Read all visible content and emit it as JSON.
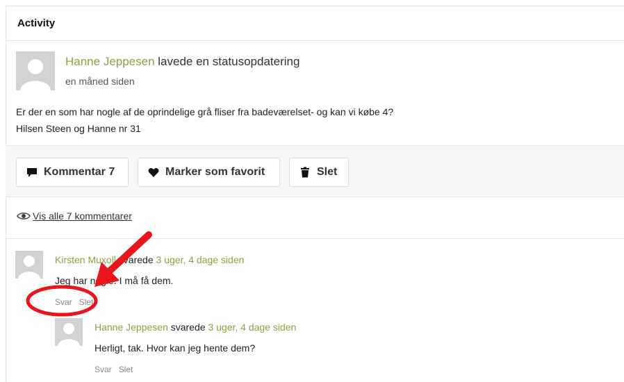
{
  "panel": {
    "title": "Activity"
  },
  "post": {
    "author": "Hanne Jeppesen",
    "action": "lavede en statusopdatering",
    "time": "en måned siden",
    "body_line1": "Er der en som har nogle af de oprindelige grå fliser fra badeværelset- og kan vi købe 4?",
    "body_line2": "Hilsen Steen og Hanne nr 31"
  },
  "actions": {
    "comment_label": "Kommentar 7",
    "favorite_label": "Marker som favorit",
    "delete_label": "Slet"
  },
  "view_all": {
    "label": "Vis alle 7 kommentarer"
  },
  "comments": [
    {
      "author": "Kirsten Muxoll",
      "verb": " svarede ",
      "time": "3 uger, 4 dage siden",
      "text": "Jeg har nogle. I må få dem.",
      "reply_label": "Svar",
      "delete_label": "Slet"
    },
    {
      "author": "Hanne Jeppesen",
      "verb": " svarede ",
      "time": "3 uger, 4 dage siden",
      "text": "Herligt, tak. Hvor kan jeg hente dem?",
      "reply_label": "Svar",
      "delete_label": "Slet"
    }
  ],
  "colors": {
    "accent": "#8ba446",
    "annotation": "#e8151b"
  },
  "icons": {
    "comment": "speech-bubble-icon",
    "favorite": "heart-icon",
    "delete": "trash-icon",
    "view": "eye-icon",
    "avatar": "default-avatar-icon"
  }
}
